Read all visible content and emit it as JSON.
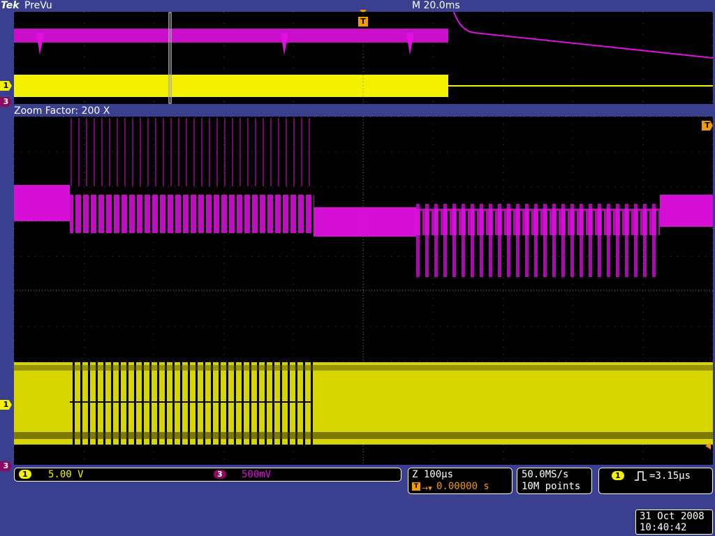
{
  "header": {
    "brand": "Tek",
    "mode": "PreVu",
    "timebase": "M 20.0ms"
  },
  "zoom": {
    "label": "Zoom Factor: 200 X"
  },
  "markers": {
    "ch1": "1",
    "ch3": "3",
    "trigger": "T"
  },
  "colors": {
    "ch1": "#f4f200",
    "ch3": "#e010e0",
    "trigger": "#f39a00",
    "background": "#3a3f8f",
    "screen": "#000000"
  },
  "status": {
    "ch1_num": "1",
    "ch1_scale": "5.00 V",
    "ch3_num": "3",
    "ch3_scale": "500mV",
    "zoom_time": "Z 100µs",
    "trigger_pos": "0.00000 s",
    "sample_rate": "50.0MS/s",
    "record_length": "10M points",
    "trig_ch_num": "1",
    "pulse_width": "=3.15µs"
  },
  "datetime": {
    "date": "31 Oct  2008",
    "time": "10:40:42"
  }
}
